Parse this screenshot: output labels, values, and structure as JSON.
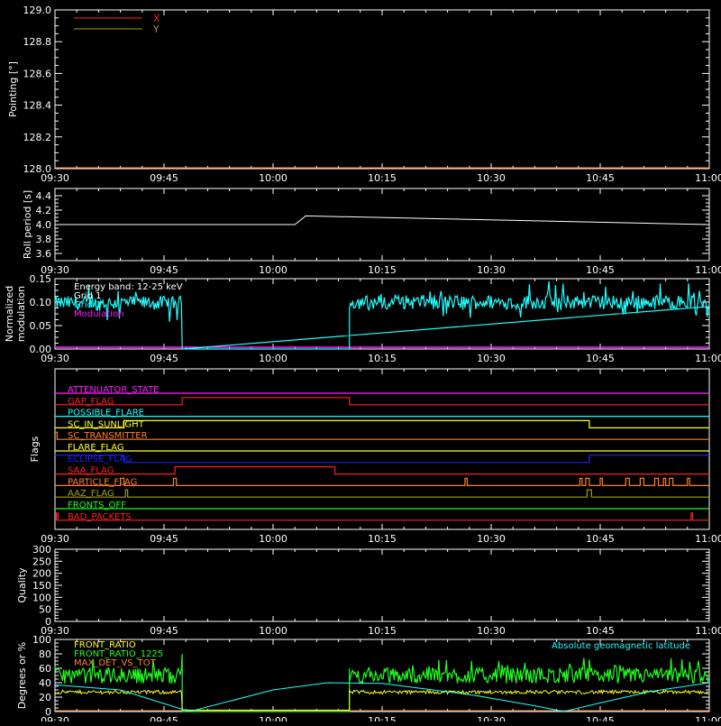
{
  "time_ticks": [
    "09:30",
    "09:45",
    "10:00",
    "10:15",
    "10:30",
    "10:45",
    "11:00"
  ],
  "colors": {
    "frame": "#ffffff",
    "red": "#ff2020",
    "olive": "#a0a020",
    "cyan": "#20ffff",
    "magenta": "#ff20ff",
    "green": "#20ff20",
    "yellow": "#ffff20",
    "orange": "#ff8020",
    "blue": "#2020ff"
  },
  "chart_data": [
    {
      "id": "pointing",
      "type": "line",
      "ylabel": "Pointing [°]",
      "ylim": [
        128.0,
        129.0
      ],
      "yticks": [
        "128.0",
        "128.2",
        "128.4",
        "128.6",
        "128.8",
        "129.0"
      ],
      "legend": [
        {
          "name": "X",
          "color": "#ff2020"
        },
        {
          "name": "Y",
          "color": "#a0a020"
        }
      ],
      "series": []
    },
    {
      "id": "roll",
      "type": "line",
      "ylabel": "Roll period [s]",
      "ylim": [
        3.5,
        4.5
      ],
      "yticks": [
        "3.6",
        "3.8",
        "4.0",
        "4.2",
        "4.4"
      ],
      "series": [
        {
          "x_min": [
            0,
            33,
            34.5,
            90
          ],
          "y": [
            4.0,
            4.0,
            4.12,
            4.0
          ]
        }
      ]
    },
    {
      "id": "modulation",
      "type": "line",
      "ylabel_lines": [
        "Normalized",
        "modulation"
      ],
      "ylim": [
        0.0,
        0.15
      ],
      "yticks": [
        "0.00",
        "0.05",
        "0.10",
        "0.15"
      ],
      "annotations": [
        {
          "text": "Energy band: 12-25 keV",
          "color": "#ffffff"
        },
        {
          "text": "Grid 1",
          "color": "#ffffff"
        },
        {
          "text": "Grid 3",
          "color": "#20ffff"
        },
        {
          "text": "Modulation",
          "color": "#ff20ff"
        }
      ],
      "segments": [
        {
          "start_min": 0,
          "end_min": 17.5,
          "mean": 0.098
        },
        {
          "start_min": 40.5,
          "end_min": 90,
          "mean": 0.1
        }
      ]
    },
    {
      "id": "flags",
      "type": "line",
      "ylabel": "Flags",
      "flags": [
        {
          "name": "ATTENUATOR_STATE",
          "color": "#ff20ff",
          "steps": []
        },
        {
          "name": "GAP_FLAG",
          "color": "#ff2020",
          "steps": [
            [
              0,
              0
            ],
            [
              17.5,
              1
            ],
            [
              40.5,
              0
            ]
          ]
        },
        {
          "name": "POSSIBLE_FLARE",
          "color": "#20ffff",
          "steps": []
        },
        {
          "name": "SC_IN_SUNLIGHT",
          "color": "#ffff20",
          "steps": [
            [
              0,
              0
            ],
            [
              9.5,
              1
            ],
            [
              73.5,
              0
            ]
          ]
        },
        {
          "name": "SC_TRANSMITTER",
          "color": "#ff8020",
          "steps": [
            [
              0,
              1
            ],
            [
              0.3,
              0
            ]
          ]
        },
        {
          "name": "FLARE_FLAG",
          "color": "#ffff20",
          "steps": []
        },
        {
          "name": "ECLIPSE_FLAG",
          "color": "#2020ff",
          "steps": [
            [
              0,
              1
            ],
            [
              9.5,
              0
            ],
            [
              73.5,
              1
            ]
          ]
        },
        {
          "name": "SAA_FLAG",
          "color": "#ff2020",
          "steps": [
            [
              0,
              0
            ],
            [
              16.5,
              1
            ],
            [
              38.5,
              0
            ]
          ]
        },
        {
          "name": "PARTICLE_FLAG",
          "color": "#ff8020",
          "steps": [
            [
              0,
              0
            ],
            [
              9,
              1
            ],
            [
              9.5,
              0
            ],
            [
              16.3,
              1
            ],
            [
              16.7,
              0
            ],
            [
              56.4,
              1
            ],
            [
              56.7,
              0
            ],
            [
              72.2,
              1
            ],
            [
              72.5,
              0
            ],
            [
              73,
              1
            ],
            [
              73.5,
              0
            ],
            [
              75,
              1
            ],
            [
              75.3,
              0
            ],
            [
              78.5,
              1
            ],
            [
              79,
              0
            ],
            [
              80.5,
              1
            ],
            [
              81,
              0
            ],
            [
              82.5,
              1
            ],
            [
              83,
              0
            ],
            [
              83.7,
              1
            ],
            [
              84,
              0
            ],
            [
              84.5,
              1
            ],
            [
              85,
              0
            ],
            [
              87,
              1
            ],
            [
              87.3,
              0
            ]
          ]
        },
        {
          "name": "AAZ_FLAG",
          "color": "#a0a020",
          "steps": [
            [
              0,
              0
            ],
            [
              9.7,
              1
            ],
            [
              10,
              0
            ],
            [
              73.2,
              1
            ],
            [
              73.8,
              0
            ]
          ]
        },
        {
          "name": "FRONTS_OFF",
          "color": "#20ff20",
          "steps": []
        },
        {
          "name": "BAD_PACKETS",
          "color": "#ff2020",
          "steps": [
            [
              0,
              0
            ],
            [
              0.2,
              1
            ],
            [
              0.4,
              0
            ],
            [
              87.5,
              1
            ],
            [
              87.7,
              0
            ]
          ]
        }
      ]
    },
    {
      "id": "quality",
      "type": "line",
      "ylabel": "Quality",
      "ylim": [
        0,
        300
      ],
      "yticks": [
        "0",
        "50",
        "100",
        "150",
        "200",
        "250",
        "300"
      ],
      "series": []
    },
    {
      "id": "ratios",
      "type": "line",
      "ylabel": "Degrees or %",
      "ylim": [
        0,
        100
      ],
      "yticks": [
        "0",
        "20",
        "40",
        "60",
        "80",
        "100"
      ],
      "legend": [
        {
          "name": "FRONT_RATIO",
          "color": "#ffff20"
        },
        {
          "name": "FRONT_RATIO_1225",
          "color": "#20ff20"
        },
        {
          "name": "MAX_DET_VS_TOT",
          "color": "#ff8020"
        },
        {
          "name": "Absolute geomagnetic latitude",
          "color": "#20ffff"
        }
      ],
      "segments": [
        {
          "start_min": 0,
          "end_min": 17.5
        },
        {
          "start_min": 40.5,
          "end_min": 90
        }
      ],
      "latitude": {
        "x_min": [
          0,
          9,
          18.5,
          30,
          37.5,
          45,
          52,
          58,
          66,
          70,
          75,
          82,
          90
        ],
        "y": [
          37,
          30,
          0,
          30,
          40,
          39,
          30,
          22,
          8,
          0,
          12,
          28,
          40
        ]
      }
    }
  ]
}
